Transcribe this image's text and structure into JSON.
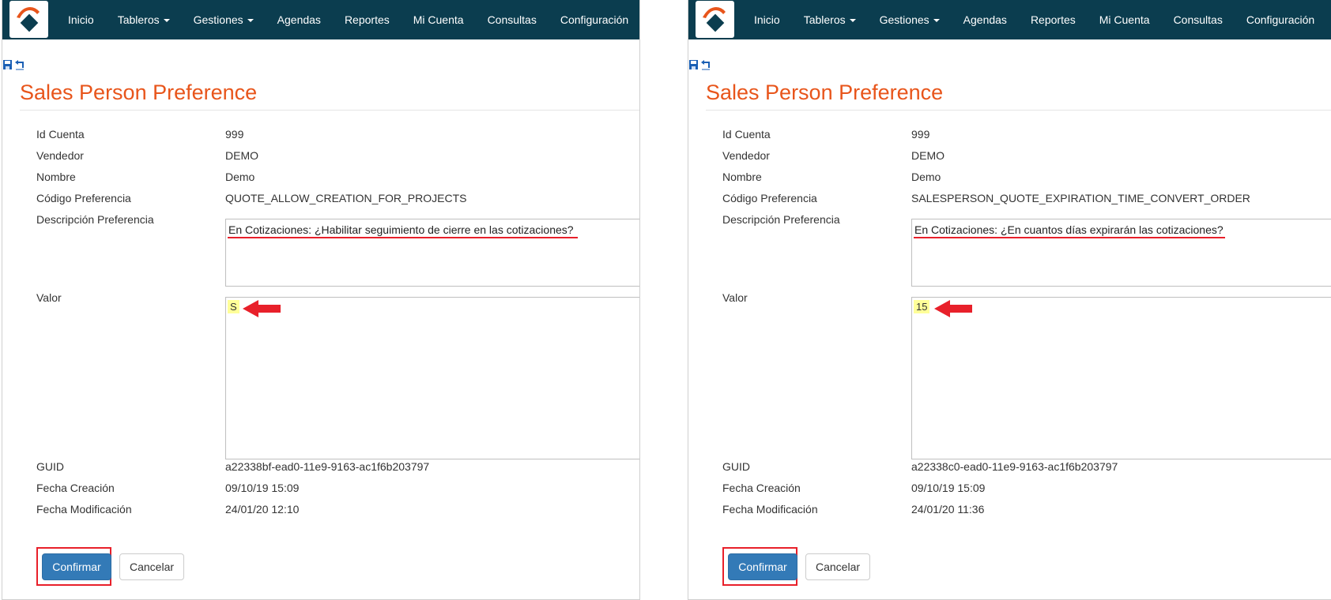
{
  "nav": {
    "items": [
      {
        "label": "Inicio",
        "dropdown": false
      },
      {
        "label": "Tableros",
        "dropdown": true
      },
      {
        "label": "Gestiones",
        "dropdown": true
      },
      {
        "label": "Agendas",
        "dropdown": false
      },
      {
        "label": "Reportes",
        "dropdown": false
      },
      {
        "label": "Mi Cuenta",
        "dropdown": false
      },
      {
        "label": "Consultas",
        "dropdown": false
      },
      {
        "label": "Configuración",
        "dropdown": false
      }
    ]
  },
  "toolbar": {
    "icons": [
      "save-icon",
      "undo-icon"
    ]
  },
  "colors": {
    "navbar": "#0b3d4f",
    "title": "#e8551b",
    "primary_button": "#337ab7",
    "annotation_red": "#e8202a",
    "highlight": "#ffff99"
  },
  "panels": [
    {
      "title": "Sales Person Preference",
      "fields": {
        "id_cuenta": {
          "label": "Id Cuenta",
          "value": "999"
        },
        "vendedor": {
          "label": "Vendedor",
          "value": "DEMO"
        },
        "nombre": {
          "label": "Nombre",
          "value": "Demo"
        },
        "codigo": {
          "label": "Código Preferencia",
          "value": "QUOTE_ALLOW_CREATION_FOR_PROJECTS"
        },
        "descripcion": {
          "label": "Descripción Preferencia",
          "value": "En Cotizaciones: ¿Habilitar seguimiento de cierre en las cotizaciones?"
        },
        "valor": {
          "label": "Valor",
          "value": "S"
        },
        "guid": {
          "label": "GUID",
          "value": "a22338bf-ead0-11e9-9163-ac1f6b203797"
        },
        "fecha_creacion": {
          "label": "Fecha Creación",
          "value": "09/10/19 15:09"
        },
        "fecha_modificacion": {
          "label": "Fecha Modificación",
          "value": "24/01/20 12:10"
        }
      },
      "buttons": {
        "confirm": "Confirmar",
        "cancel": "Cancelar"
      }
    },
    {
      "title": "Sales Person Preference",
      "fields": {
        "id_cuenta": {
          "label": "Id Cuenta",
          "value": "999"
        },
        "vendedor": {
          "label": "Vendedor",
          "value": "DEMO"
        },
        "nombre": {
          "label": "Nombre",
          "value": "Demo"
        },
        "codigo": {
          "label": "Código Preferencia",
          "value": "SALESPERSON_QUOTE_EXPIRATION_TIME_CONVERT_ORDER"
        },
        "descripcion": {
          "label": "Descripción Preferencia",
          "value": "En Cotizaciones: ¿En cuantos días expirarán las cotizaciones?"
        },
        "valor": {
          "label": "Valor",
          "value": "15"
        },
        "guid": {
          "label": "GUID",
          "value": "a22338c0-ead0-11e9-9163-ac1f6b203797"
        },
        "fecha_creacion": {
          "label": "Fecha Creación",
          "value": "09/10/19 15:09"
        },
        "fecha_modificacion": {
          "label": "Fecha Modificación",
          "value": "24/01/20 11:36"
        }
      },
      "buttons": {
        "confirm": "Confirmar",
        "cancel": "Cancelar"
      }
    }
  ]
}
